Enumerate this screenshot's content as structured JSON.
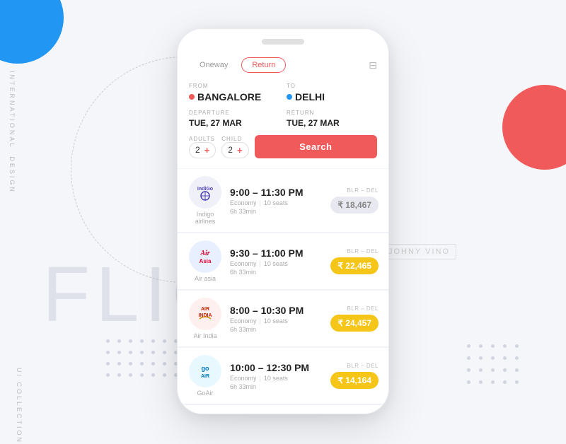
{
  "background": {
    "flic_text": "FLIC",
    "johny_vino_label": "JOHNY VINO",
    "vertical_label_1": "INTERNATIONAL",
    "vertical_label_2": "DESIGN",
    "vertical_label_3": "UI COLLECTION"
  },
  "phone": {
    "trip_tabs": {
      "oneway": "Oneway",
      "return": "Return",
      "active": "return"
    },
    "from": {
      "label": "FROM",
      "value": "BANGALORE"
    },
    "to": {
      "label": "TO",
      "value": "DELHI"
    },
    "departure": {
      "label": "DEPARTURE",
      "value": "TUE, 27 MAR"
    },
    "return_date": {
      "label": "RETURN",
      "value": "TUE, 27 MAR"
    },
    "adults": {
      "label": "ADULTS",
      "value": "2",
      "plus": "+"
    },
    "child": {
      "label": "CHILD",
      "value": "2",
      "plus": "+"
    },
    "search_button": "Search",
    "flights": [
      {
        "airline": "Indigo airlines",
        "time": "9:00 – 11:30 PM",
        "class": "Economy",
        "seats": "10 seats",
        "duration": "6h 33min",
        "route": "BLR – DEL",
        "price": "₹ 18,467",
        "price_style": "grey"
      },
      {
        "airline": "Air asia",
        "time": "9:30 – 11:00 PM",
        "class": "Economy",
        "seats": "10 seats",
        "duration": "6h 33min",
        "route": "BLR – DEL",
        "price": "₹ 22,465",
        "price_style": "yellow"
      },
      {
        "airline": "Air India",
        "time": "8:00 – 10:30 PM",
        "class": "Economy",
        "seats": "10 seats",
        "duration": "6h 33min",
        "route": "BLR – DEL",
        "price": "₹ 24,457",
        "price_style": "yellow"
      },
      {
        "airline": "GoAir",
        "time": "10:00 – 12:30 PM",
        "class": "Economy",
        "seats": "10 seats",
        "duration": "6h 33min",
        "route": "BLR – DEL",
        "price": "₹ 14,164",
        "price_style": "yellow"
      }
    ]
  }
}
